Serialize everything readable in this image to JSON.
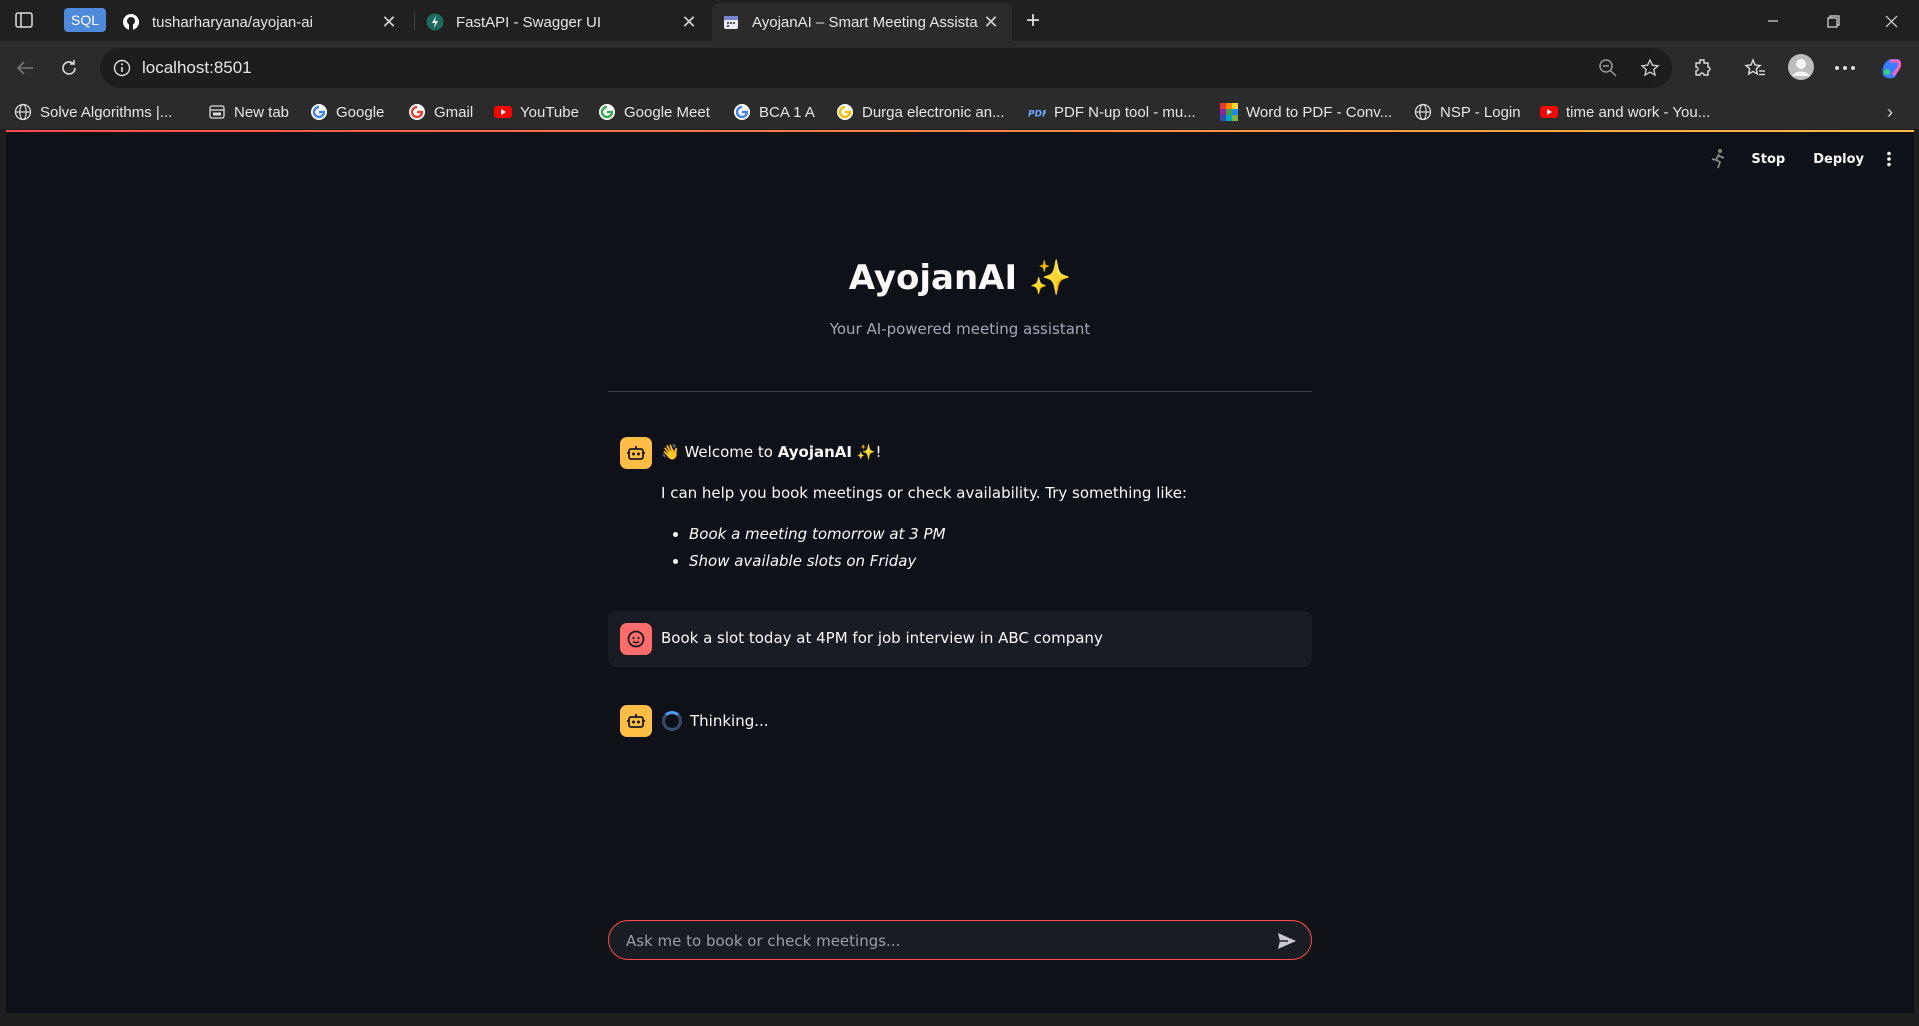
{
  "browser": {
    "tabs": [
      {
        "label": "tusharharyana/ayojan-ai",
        "icon": "github-icon"
      },
      {
        "label": "FastAPI - Swagger UI",
        "icon": "fastapi-icon"
      },
      {
        "label": "AyojanAI – Smart Meeting Assista",
        "icon": "calendar-icon"
      }
    ],
    "sql_badge": "SQL",
    "url": "localhost:8501",
    "bookmarks": [
      {
        "label": "Solve Algorithms |...",
        "icon": "globe-icon"
      },
      {
        "label": "New tab",
        "icon": "newtab-icon"
      },
      {
        "label": "Google",
        "icon": "google-icon"
      },
      {
        "label": "Gmail",
        "icon": "google-icon"
      },
      {
        "label": "YouTube",
        "icon": "youtube-icon"
      },
      {
        "label": "Google Meet",
        "icon": "google-icon"
      },
      {
        "label": "BCA 1 A",
        "icon": "google-icon"
      },
      {
        "label": "Durga electronic an...",
        "icon": "google-icon"
      },
      {
        "label": "PDF N-up tool - mu...",
        "icon": "pdf-icon"
      },
      {
        "label": "Word to PDF - Conv...",
        "icon": "colorgrid-icon"
      },
      {
        "label": "NSP - Login",
        "icon": "globe-icon"
      },
      {
        "label": "time and work - You...",
        "icon": "youtube-icon"
      }
    ]
  },
  "header": {
    "stop_label": "Stop",
    "deploy_label": "Deploy"
  },
  "app": {
    "title": "AyojanAI ✨",
    "subtitle": "Your AI-powered meeting assistant"
  },
  "messages": {
    "welcome": {
      "wave": "👋",
      "prefix": "Welcome to",
      "brand": "AyojanAI",
      "sparkle": "✨",
      "suffix": "!",
      "intro": "I can help you book meetings or check availability. Try something like:",
      "examples": [
        "Book a meeting tomorrow at 3 PM",
        "Show available slots on Friday"
      ]
    },
    "user": "Book a slot today at 4PM for job interview in ABC company",
    "thinking": "Thinking..."
  },
  "chat_input": {
    "placeholder": "Ask me to book or check meetings..."
  },
  "colors": {
    "accent": "#ff4b4b",
    "bot_avatar": "#ffbd45",
    "user_avatar": "#ff6c6c",
    "background": "#0e1117"
  }
}
